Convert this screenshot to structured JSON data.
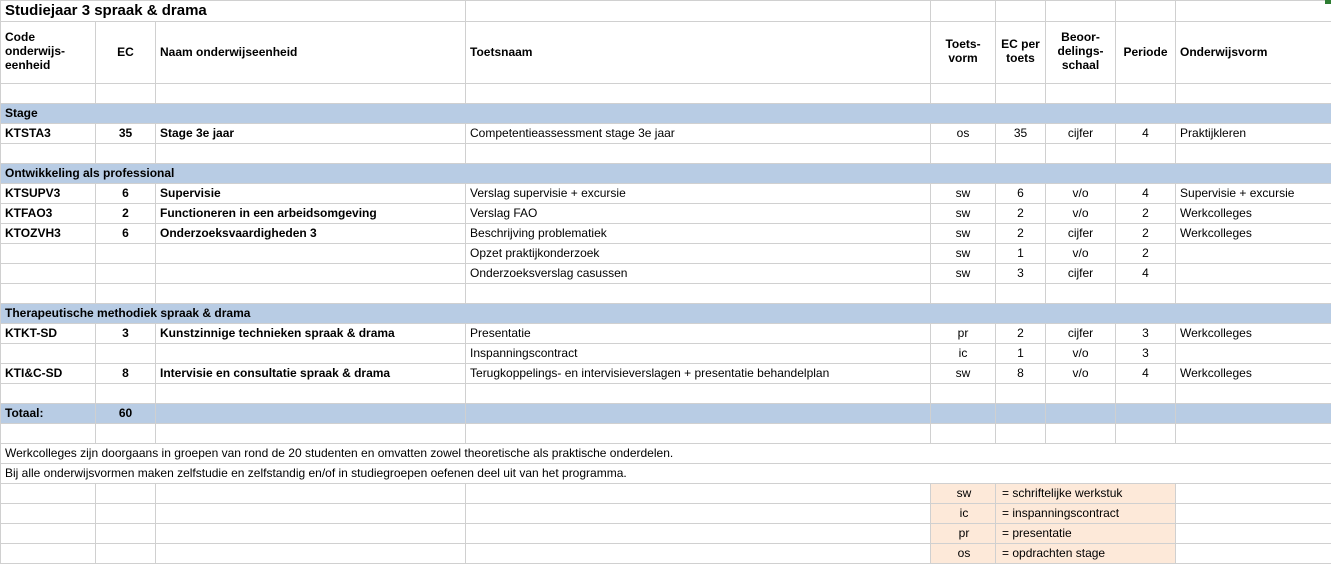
{
  "title": "Studiejaar 3 spraak & drama",
  "headers": {
    "code": "Code onderwijs-eenheid",
    "ec": "EC",
    "naam": "Naam onderwijseenheid",
    "toets": "Toetsnaam",
    "vorm": "Toets-vorm",
    "ecpt": "EC per toets",
    "schaal": "Beoor-delings-schaal",
    "per": "Periode",
    "ovorm": "Onderwijsvorm"
  },
  "sections": [
    {
      "title": "Stage",
      "rows": [
        {
          "code": "KTSTA3",
          "ec": "35",
          "naam": "Stage 3e jaar",
          "toets": "Competentieassessment stage 3e jaar",
          "vorm": "os",
          "ecpt": "35",
          "schaal": "cijfer",
          "per": "4",
          "ovorm": "Praktijkleren",
          "bold": true
        }
      ]
    },
    {
      "title": "Ontwikkeling als professional",
      "rows": [
        {
          "code": "KTSUPV3",
          "ec": "6",
          "naam": "Supervisie",
          "toets": "Verslag supervisie + excursie",
          "vorm": "sw",
          "ecpt": "6",
          "schaal": "v/o",
          "per": "4",
          "ovorm": "Supervisie + excursie",
          "bold": true
        },
        {
          "code": "KTFAO3",
          "ec": "2",
          "naam": "Functioneren in een arbeidsomgeving",
          "toets": "Verslag FAO",
          "vorm": "sw",
          "ecpt": "2",
          "schaal": "v/o",
          "per": "2",
          "ovorm": "Werkcolleges",
          "bold": true
        },
        {
          "code": "KTOZVH3",
          "ec": "6",
          "naam": "Onderzoeksvaardigheden 3",
          "toets": "Beschrijving problematiek",
          "vorm": "sw",
          "ecpt": "2",
          "schaal": "cijfer",
          "per": "2",
          "ovorm": "Werkcolleges",
          "bold": true
        },
        {
          "code": "",
          "ec": "",
          "naam": "",
          "toets": "Opzet praktijkonderzoek",
          "vorm": "sw",
          "ecpt": "1",
          "schaal": "v/o",
          "per": "2",
          "ovorm": ""
        },
        {
          "code": "",
          "ec": "",
          "naam": "",
          "toets": "Onderzoeksverslag casussen",
          "vorm": "sw",
          "ecpt": "3",
          "schaal": "cijfer",
          "per": "4",
          "ovorm": ""
        }
      ]
    },
    {
      "title": "Therapeutische methodiek spraak & drama",
      "rows": [
        {
          "code": "KTKT-SD",
          "ec": "3",
          "naam": "Kunstzinnige technieken spraak & drama",
          "toets": "Presentatie",
          "vorm": "pr",
          "ecpt": "2",
          "schaal": "cijfer",
          "per": "3",
          "ovorm": "Werkcolleges",
          "bold": true
        },
        {
          "code": "",
          "ec": "",
          "naam": "",
          "toets": "Inspanningscontract",
          "vorm": "ic",
          "ecpt": "1",
          "schaal": "v/o",
          "per": "3",
          "ovorm": ""
        },
        {
          "code": "KTI&C-SD",
          "ec": "8",
          "naam": "Intervisie en consultatie spraak & drama",
          "toets": "Terugkoppelings- en intervisieverslagen + presentatie behandelplan",
          "vorm": "sw",
          "ecpt": "8",
          "schaal": "v/o",
          "per": "4",
          "ovorm": "Werkcolleges",
          "bold": true
        }
      ]
    }
  ],
  "total": {
    "label": "Totaal:",
    "ec": "60"
  },
  "notes": [
    "Werkcolleges zijn doorgaans in groepen van rond de 20 studenten en omvatten zowel theoretische als praktische onderdelen.",
    "Bij alle onderwijsvormen maken zelfstudie en zelfstandig en/of in studiegroepen oefenen deel uit van het programma."
  ],
  "legend": [
    {
      "k": "sw",
      "v": "= schriftelijke werkstuk"
    },
    {
      "k": "ic",
      "v": "= inspanningscontract"
    },
    {
      "k": "pr",
      "v": "= presentatie"
    },
    {
      "k": "os",
      "v": "= opdrachten stage"
    }
  ]
}
